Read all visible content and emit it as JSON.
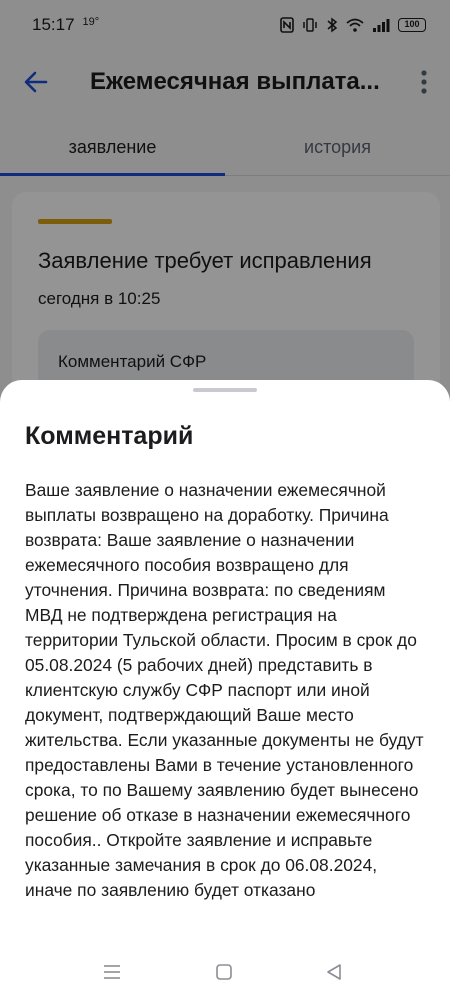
{
  "status_bar": {
    "time": "15:17",
    "temperature": "19°",
    "battery": "100",
    "icons": [
      "nfc-icon",
      "vibrate-icon",
      "bluetooth-icon",
      "wifi-icon",
      "signal-icon",
      "battery-icon"
    ]
  },
  "app_bar": {
    "title": "Ежемесячная выплата...",
    "icons": [
      "back-arrow-icon",
      "more-vertical-icon"
    ]
  },
  "tabs": [
    {
      "label": "заявление",
      "active": true
    },
    {
      "label": "история",
      "active": false
    }
  ],
  "card": {
    "status_color": "#d4a012",
    "title": "Заявление требует исправления",
    "date": "сегодня в 10:25",
    "comment_label": "Комментарий СФР"
  },
  "sheet": {
    "title": "Комментарий",
    "body": "Ваше заявление о назначении ежемесячной выплаты возвращено на доработку. Причина возврата: Ваше заявление о назначении ежемесячного пособия возвращено для уточнения. Причина возврата: по сведениям МВД не подтверждена регистрация на территории Тульской области. Просим в срок до 05.08.2024 (5 рабочих дней) представить в клиентскую службу СФР паспорт или иной документ, подтверждающий Ваше место жительства. Если указанные документы не будут предоставлены Вами в течение установленного срока, то по Вашему заявлению будет вынесено решение об отказе в назначении ежемесячного пособия.. Откройте заявление и исправьте указанные замечания в срок до 06.08.2024, иначе по заявлению будет отказано"
  },
  "nav_bar": {
    "icons": [
      "recent-apps-icon",
      "home-icon",
      "back-triangle-icon"
    ]
  },
  "colors": {
    "accent": "#1d4ed8",
    "scrim": "rgba(0,0,0,0.42)",
    "status_stripe": "#d4a012"
  }
}
